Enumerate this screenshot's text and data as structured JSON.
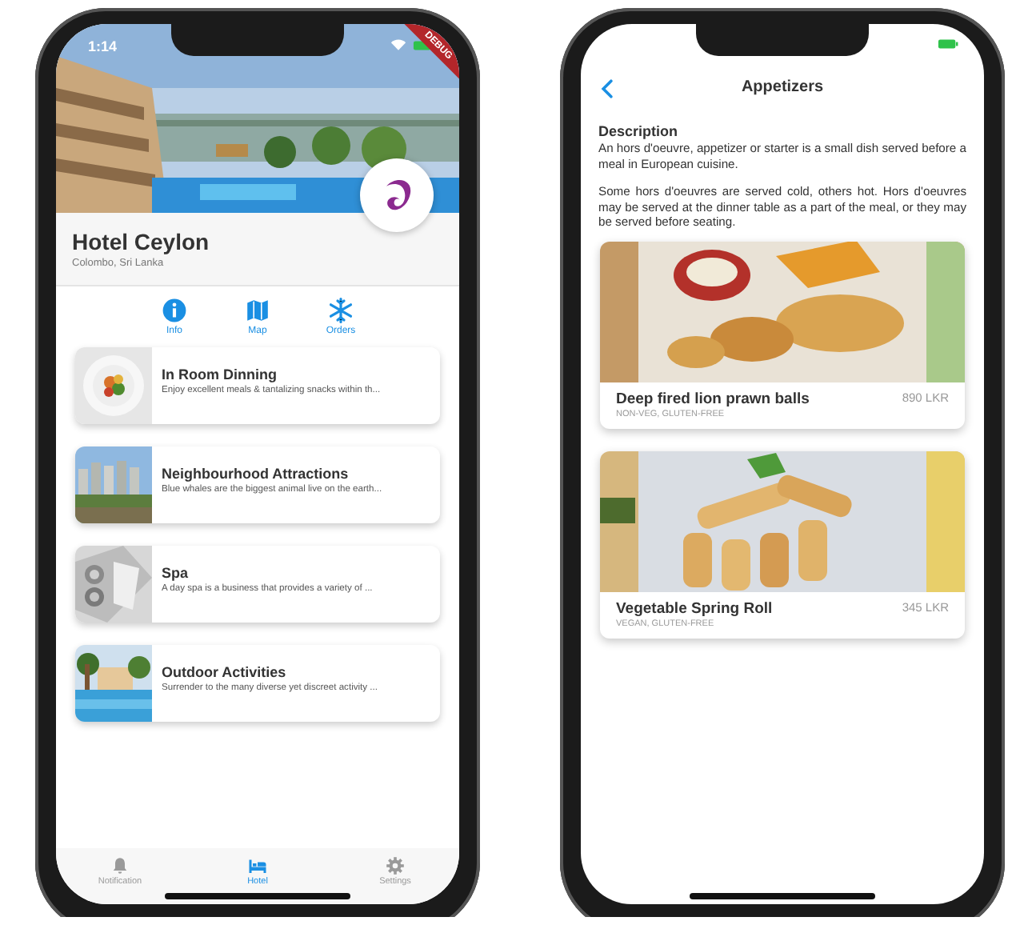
{
  "hotel_screen": {
    "status_bar": {
      "time": "1:14"
    },
    "debug_banner": "DEBUG",
    "hotel": {
      "name": "Hotel Ceylon",
      "location": "Colombo, Sri Lanka"
    },
    "quick_actions": [
      {
        "kind": "info",
        "label": "Info"
      },
      {
        "kind": "map",
        "label": "Map"
      },
      {
        "kind": "orders",
        "label": "Orders"
      }
    ],
    "services": [
      {
        "title": "In Room Dinning",
        "subtitle": "Enjoy excellent meals & tantalizing snacks within th..."
      },
      {
        "title": "Neighbourhood Attractions",
        "subtitle": "Blue whales are the biggest animal live on the earth..."
      },
      {
        "title": "Spa",
        "subtitle": "A day spa is a business that provides a variety of ..."
      },
      {
        "title": "Outdoor Activities",
        "subtitle": "Surrender to the many diverse yet discreet activity ..."
      }
    ],
    "tab_bar": [
      {
        "kind": "bell",
        "label": "Notification",
        "selected": false
      },
      {
        "kind": "bed",
        "label": "Hotel",
        "selected": true
      },
      {
        "kind": "gear",
        "label": "Settings",
        "selected": false
      }
    ]
  },
  "menu_screen": {
    "title": "Appetizers",
    "description": {
      "heading": "Description",
      "paragraphs": [
        "An hors d'oeuvre, appetizer or starter is a small dish served before a meal in European cuisine.",
        "Some hors d'oeuvres are served cold, others hot. Hors d'oeuvres may be served at the dinner table as a part of the meal, or they may be served before seating."
      ]
    },
    "dishes": [
      {
        "name": "Deep fired lion prawn balls",
        "tags": "NON-VEG, GLUTEN-FREE",
        "price": "890 LKR"
      },
      {
        "name": "Vegetable Spring Roll",
        "tags": "VEGAN, GLUTEN-FREE",
        "price": "345 LKR"
      }
    ]
  }
}
